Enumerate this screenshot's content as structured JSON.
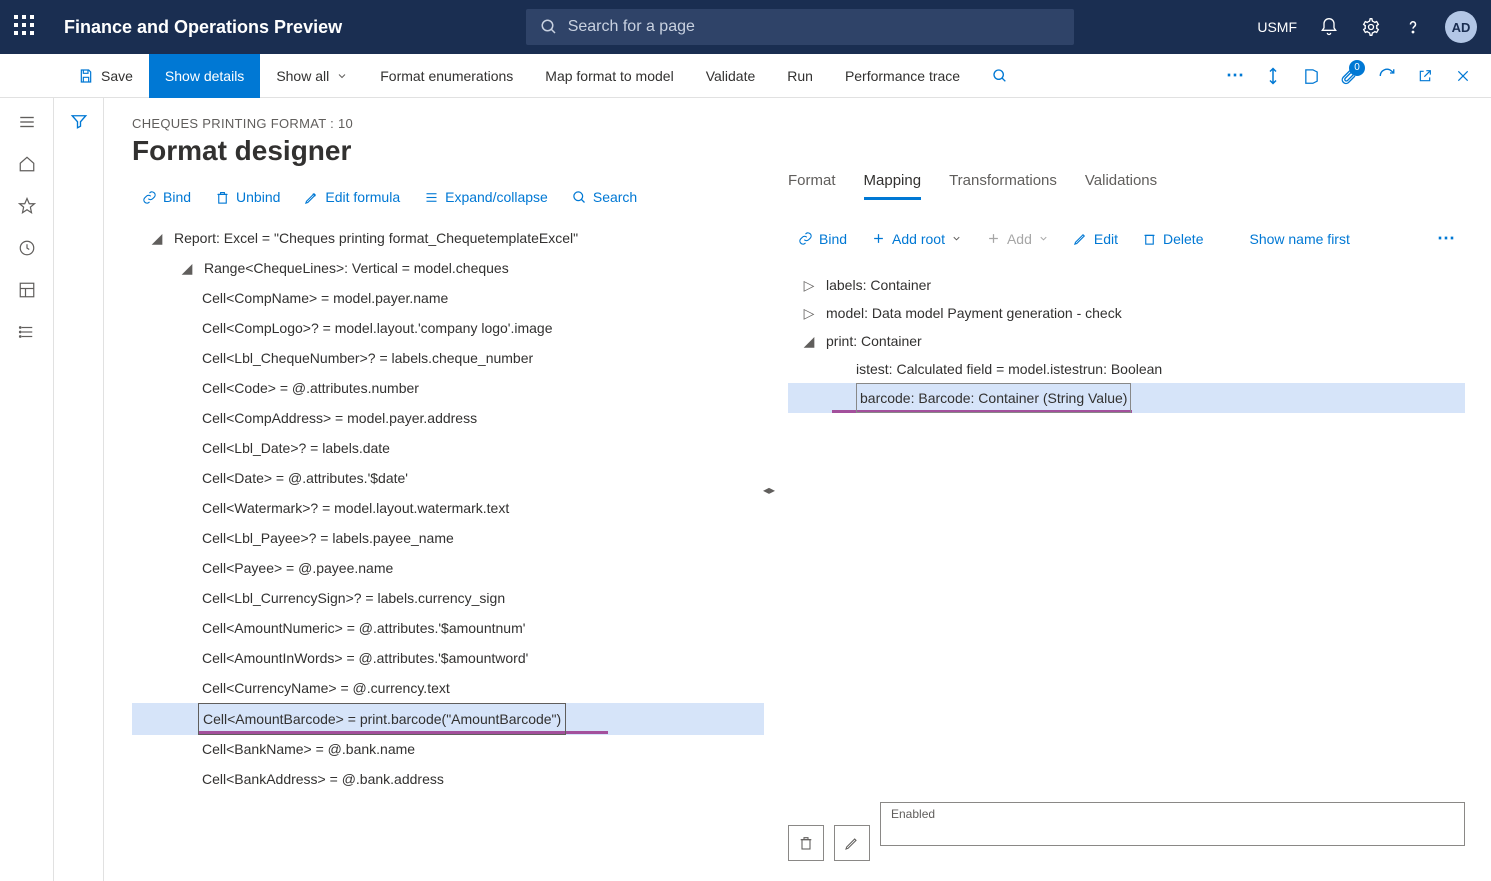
{
  "header": {
    "app_title": "Finance and Operations Preview",
    "search_placeholder": "Search for a page",
    "environment": "USMF",
    "avatar_initials": "AD"
  },
  "commandbar": {
    "save": "Save",
    "show_details": "Show details",
    "show_all": "Show all",
    "format_enum": "Format enumerations",
    "map_format": "Map format to model",
    "validate": "Validate",
    "run": "Run",
    "perf_trace": "Performance trace",
    "attachments_badge": "0"
  },
  "page": {
    "breadcrumb": "CHEQUES PRINTING FORMAT : 10",
    "title": "Format designer"
  },
  "tree_toolbar": {
    "bind": "Bind",
    "unbind": "Unbind",
    "edit_formula": "Edit formula",
    "expand": "Expand/collapse",
    "search": "Search"
  },
  "tree": {
    "root": "Report: Excel = \"Cheques printing format_ChequetemplateExcel\"",
    "range": "Range<ChequeLines>: Vertical = model.cheques",
    "cells": [
      "Cell<CompName> = model.payer.name",
      "Cell<CompLogo>? = model.layout.'company logo'.image",
      "Cell<Lbl_ChequeNumber>? = labels.cheque_number",
      "Cell<Code> = @.attributes.number",
      "Cell<CompAddress> = model.payer.address",
      "Cell<Lbl_Date>? = labels.date",
      "Cell<Date> = @.attributes.'$date'",
      "Cell<Watermark>? = model.layout.watermark.text",
      "Cell<Lbl_Payee>? = labels.payee_name",
      "Cell<Payee> = @.payee.name",
      "Cell<Lbl_CurrencySign>? = labels.currency_sign",
      "Cell<AmountNumeric> = @.attributes.'$amountnum'",
      "Cell<AmountInWords> = @.attributes.'$amountword'",
      "Cell<CurrencyName> = @.currency.text",
      "Cell<AmountBarcode> = print.barcode(\"AmountBarcode\")",
      "Cell<BankName> = @.bank.name",
      "Cell<BankAddress> = @.bank.address"
    ],
    "selected_index": 14
  },
  "right": {
    "tabs": {
      "format": "Format",
      "mapping": "Mapping",
      "transformations": "Transformations",
      "validations": "Validations"
    },
    "toolbar": {
      "bind": "Bind",
      "add_root": "Add root",
      "add": "Add",
      "edit": "Edit",
      "delete": "Delete",
      "show_name": "Show name first"
    },
    "mtree": {
      "labels": "labels: Container",
      "model": "model: Data model Payment generation - check",
      "print": "print: Container",
      "istest": "istest: Calculated field = model.istestrun: Boolean",
      "barcode": "barcode: Barcode: Container (String Value)"
    },
    "enabled_label": "Enabled"
  }
}
